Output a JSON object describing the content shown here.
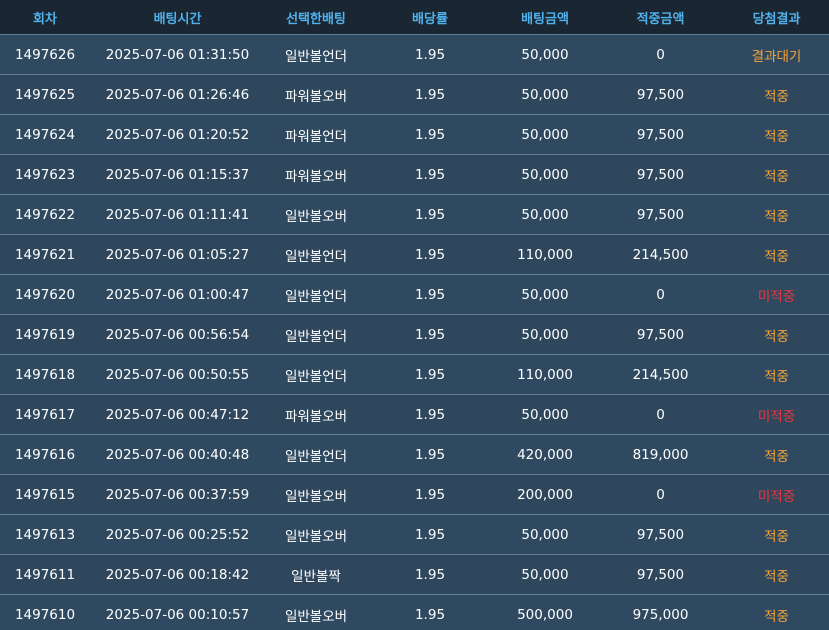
{
  "colors": {
    "header_bg": "#1b2633",
    "header_text": "#4fb2ec",
    "row_bg": "#2e475c",
    "text": "#ffffff",
    "win": "#f5a23a",
    "lose": "#e8363f"
  },
  "headers": [
    "회차",
    "배팅시간",
    "선택한배팅",
    "배당률",
    "배팅금액",
    "적중금액",
    "당첨결과"
  ],
  "rows": [
    {
      "round": "1497626",
      "time": "2025-07-06 01:31:50",
      "pick": "일반볼언더",
      "odds": "1.95",
      "bet": "50,000",
      "payout": "0",
      "result": "결과대기",
      "status": "wait"
    },
    {
      "round": "1497625",
      "time": "2025-07-06 01:26:46",
      "pick": "파워볼오버",
      "odds": "1.95",
      "bet": "50,000",
      "payout": "97,500",
      "result": "적중",
      "status": "win"
    },
    {
      "round": "1497624",
      "time": "2025-07-06 01:20:52",
      "pick": "파워볼언더",
      "odds": "1.95",
      "bet": "50,000",
      "payout": "97,500",
      "result": "적중",
      "status": "win"
    },
    {
      "round": "1497623",
      "time": "2025-07-06 01:15:37",
      "pick": "파워볼오버",
      "odds": "1.95",
      "bet": "50,000",
      "payout": "97,500",
      "result": "적중",
      "status": "win"
    },
    {
      "round": "1497622",
      "time": "2025-07-06 01:11:41",
      "pick": "일반볼오버",
      "odds": "1.95",
      "bet": "50,000",
      "payout": "97,500",
      "result": "적중",
      "status": "win"
    },
    {
      "round": "1497621",
      "time": "2025-07-06 01:05:27",
      "pick": "일반볼언더",
      "odds": "1.95",
      "bet": "110,000",
      "payout": "214,500",
      "result": "적중",
      "status": "win"
    },
    {
      "round": "1497620",
      "time": "2025-07-06 01:00:47",
      "pick": "일반볼언더",
      "odds": "1.95",
      "bet": "50,000",
      "payout": "0",
      "result": "미적중",
      "status": "lose"
    },
    {
      "round": "1497619",
      "time": "2025-07-06 00:56:54",
      "pick": "일반볼언더",
      "odds": "1.95",
      "bet": "50,000",
      "payout": "97,500",
      "result": "적중",
      "status": "win"
    },
    {
      "round": "1497618",
      "time": "2025-07-06 00:50:55",
      "pick": "일반볼언더",
      "odds": "1.95",
      "bet": "110,000",
      "payout": "214,500",
      "result": "적중",
      "status": "win"
    },
    {
      "round": "1497617",
      "time": "2025-07-06 00:47:12",
      "pick": "파워볼오버",
      "odds": "1.95",
      "bet": "50,000",
      "payout": "0",
      "result": "미적중",
      "status": "lose"
    },
    {
      "round": "1497616",
      "time": "2025-07-06 00:40:48",
      "pick": "일반볼언더",
      "odds": "1.95",
      "bet": "420,000",
      "payout": "819,000",
      "result": "적중",
      "status": "win"
    },
    {
      "round": "1497615",
      "time": "2025-07-06 00:37:59",
      "pick": "일반볼오버",
      "odds": "1.95",
      "bet": "200,000",
      "payout": "0",
      "result": "미적중",
      "status": "lose"
    },
    {
      "round": "1497613",
      "time": "2025-07-06 00:25:52",
      "pick": "일반볼오버",
      "odds": "1.95",
      "bet": "50,000",
      "payout": "97,500",
      "result": "적중",
      "status": "win"
    },
    {
      "round": "1497611",
      "time": "2025-07-06 00:18:42",
      "pick": "일반볼짝",
      "odds": "1.95",
      "bet": "50,000",
      "payout": "97,500",
      "result": "적중",
      "status": "win"
    },
    {
      "round": "1497610",
      "time": "2025-07-06 00:10:57",
      "pick": "일반볼오버",
      "odds": "1.95",
      "bet": "500,000",
      "payout": "975,000",
      "result": "적중",
      "status": "win"
    }
  ]
}
